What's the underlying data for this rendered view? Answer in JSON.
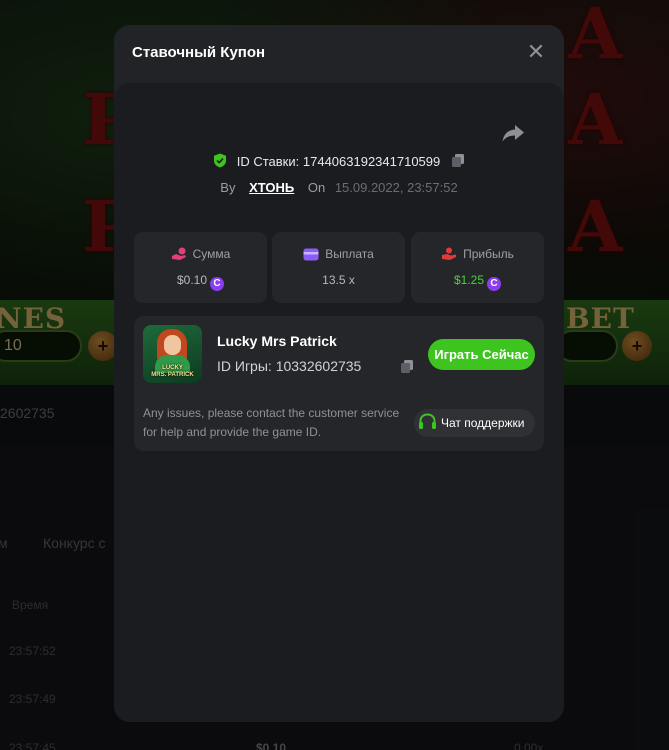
{
  "background": {
    "game_words": {
      "left": "NES",
      "right": "BET"
    },
    "game_pills": {
      "left_value": "10"
    },
    "game_id_fragment": "2602735",
    "tabs": [
      "м",
      "Конкурс с"
    ],
    "table_header_time": "Время",
    "table_rows": [
      {
        "time": "23:57:52"
      },
      {
        "time": "23:57:49"
      },
      {
        "time": "23:57:45",
        "amount": "$0.10",
        "profit": "0.00x"
      }
    ]
  },
  "modal": {
    "title": "Ставочный Купон",
    "close_glyph": "✕",
    "bet_id_label": "ID Ставки:",
    "bet_id": "1744063192341710599",
    "by_label": "By",
    "username": "ХТОНЬ",
    "on_label": "On",
    "date": "15.09.2022, 23:57:52",
    "stats": [
      {
        "icon": "hand-coins-icon",
        "label": "Сумма",
        "value": "$0.10",
        "coin": "C",
        "color": "#b5b8be"
      },
      {
        "icon": "wallet-icon",
        "label": "Выплата",
        "value": "13.5 x",
        "color": "#b5b8be"
      },
      {
        "icon": "profit-icon",
        "label": "Прибыль",
        "value": "$1.25",
        "coin": "C",
        "color": "#4cd137"
      }
    ],
    "game": {
      "name": "Lucky Mrs Patrick",
      "id_label": "ID Игры:",
      "id": "10332602735",
      "thumb_text_1": "LUCKY",
      "thumb_text_2": "MRS. PATRICK",
      "play_label": "Играть Сейчас"
    },
    "help_text": "Any issues, please contact the customer service for help and provide the game ID.",
    "support_label": "Чат поддержки"
  },
  "colors": {
    "accent_green": "#3ec41f",
    "profit_green": "#4cd137",
    "coin_purple": "#8b3df2",
    "modal_bg": "#222326",
    "inner_bg": "#1b1c1f"
  }
}
